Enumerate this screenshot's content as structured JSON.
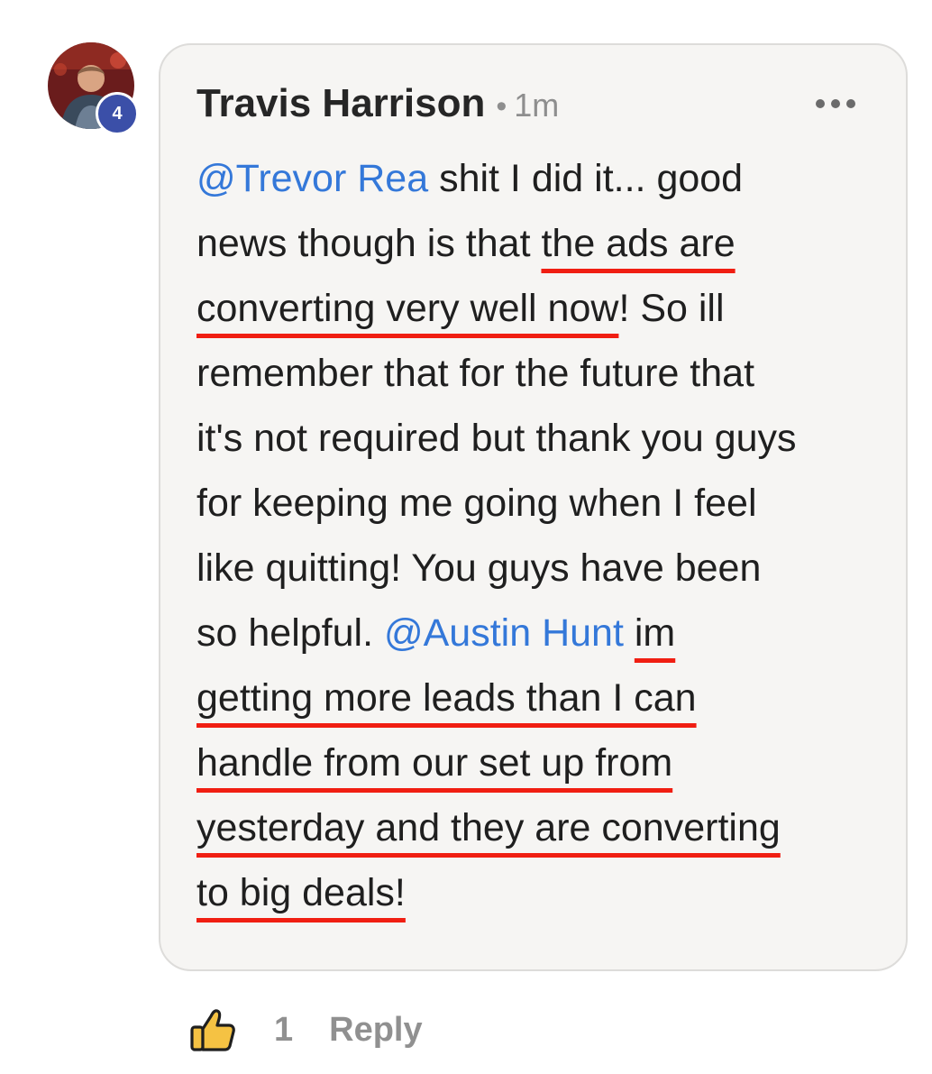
{
  "comment": {
    "author": "Travis Harrison",
    "separator": "•",
    "time": "1m",
    "level_badge": "4",
    "more_icon": "more-horizontal-icon",
    "lines": [
      {
        "segments": [
          {
            "text": "@Trevor Rea",
            "style": "mention"
          },
          {
            "text": " shit I did it... good",
            "style": "plain"
          }
        ]
      },
      {
        "segments": [
          {
            "text": "news though is that ",
            "style": "plain"
          },
          {
            "text": "the ads are",
            "style": "highlight"
          }
        ]
      },
      {
        "segments": [
          {
            "text": "converting very well now",
            "style": "highlight"
          },
          {
            "text": "! So ill",
            "style": "plain"
          }
        ]
      },
      {
        "segments": [
          {
            "text": "remember that for the future that",
            "style": "plain"
          }
        ]
      },
      {
        "segments": [
          {
            "text": "it's not required but thank you guys",
            "style": "plain"
          }
        ]
      },
      {
        "segments": [
          {
            "text": "for keeping me going when I feel",
            "style": "plain"
          }
        ]
      },
      {
        "segments": [
          {
            "text": "like quitting! You guys have been",
            "style": "plain"
          }
        ]
      },
      {
        "segments": [
          {
            "text": "so helpful. ",
            "style": "plain"
          },
          {
            "text": "@Austin Hunt",
            "style": "mention"
          },
          {
            "text": " ",
            "style": "plain"
          },
          {
            "text": "im",
            "style": "highlight"
          }
        ]
      },
      {
        "segments": [
          {
            "text": "getting more leads than I can",
            "style": "highlight"
          }
        ]
      },
      {
        "segments": [
          {
            "text": "handle from our set up from",
            "style": "highlight"
          }
        ]
      },
      {
        "segments": [
          {
            "text": "yesterday and they are converting",
            "style": "highlight"
          }
        ]
      },
      {
        "segments": [
          {
            "text": "to big deals!",
            "style": "highlight"
          }
        ]
      }
    ]
  },
  "actions": {
    "like_icon": "thumbs-up-icon",
    "like_count": "1",
    "reply_label": "Reply"
  },
  "colors": {
    "mention": "#3478d9",
    "highlight_underline": "#f01e12",
    "bubble_background": "#f6f5f3",
    "level_badge": "#3b4fa8",
    "like_icon_fill": "#f5c243"
  }
}
